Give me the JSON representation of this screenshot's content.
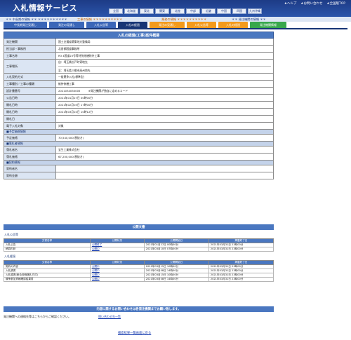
{
  "header": {
    "logo": "入札情報サービス",
    "util_links": [
      "★ヘルプ",
      "★お問い合わせ",
      "★全国版TOP"
    ],
    "regions": [
      "全国",
      "北海道",
      "東北",
      "関東",
      "北陸",
      "中部",
      "近畿",
      "中国",
      "四国",
      "九州沖縄"
    ]
  },
  "sections": {
    "a": "＊＊ 中長期の情報 ＊＊ ＊＊＊＊＊＊＊＊＊＊",
    "b": "工事の情報 ＊＊＊＊＊＊＊＊＊＊",
    "c": "業務の情報 ＊＊＊＊＊＊＊＊＊＊",
    "d": "＊＊ 発注機関の情報 ＊＊"
  },
  "tabs": [
    {
      "label": "中長期発注見通し",
      "style": "blue"
    },
    {
      "label": "発注の見通し",
      "style": "blue"
    },
    {
      "label": "入札公告等",
      "style": "blue"
    },
    {
      "label": "入札の経過",
      "style": "active"
    },
    {
      "label": "発注の見通し",
      "style": "orange"
    },
    {
      "label": "入札公告等",
      "style": "orange"
    },
    {
      "label": "入札の経過",
      "style": "orange"
    },
    {
      "label": "発注機関情報",
      "style": "green"
    }
  ],
  "detail": {
    "title": "入札の経過(工事)案件概要",
    "rows": [
      {
        "label": "発注機関",
        "value": [
          "国土交通省関東地方整備局"
        ],
        "h": 10
      },
      {
        "label": "担当部・事務所",
        "value": [
          "北首都国道事務所"
        ],
        "h": 10
      },
      {
        "label": "工事名称",
        "value": [
          "R3 4国道23号等特別修繕除外工事"
        ],
        "h": 10
      },
      {
        "label": "工事場所",
        "value": [
          "自：埼玉県杉戸町寄地先",
          "至：埼玉県三郷市高州地先"
        ],
        "h": 20
      },
      {
        "label": "入札契約方式",
        "value": [
          "一般競争入札(標準型)"
        ],
        "h": 10
      },
      {
        "label": "工事種別／工事の種類",
        "value": [
          "維持修繕工事"
        ],
        "h": 10
      },
      {
        "label": "設計書番号",
        "value": [
          "2021034050005　　　※発注機関が独自に定めるコード"
        ],
        "h": 10
      },
      {
        "label": "公告日時",
        "value": [
          "2021年01月27日 00時00分"
        ],
        "h": 10
      },
      {
        "label": "開札日時",
        "value": [
          "2021年02月03日 17時00分"
        ],
        "h": 10
      },
      {
        "label": "開札日時",
        "value": [
          "2021年03月10日 10時12分"
        ],
        "h": 10
      },
      {
        "label": "開札日",
        "value": [
          ""
        ],
        "h": 10
      },
      {
        "label": "電子入札対象",
        "value": [
          "対象"
        ],
        "h": 10
      }
    ],
    "group1": "■予定価格情報",
    "group1_rows": [
      {
        "label": "予定価格",
        "value": [
          "70,540,000(税抜き)"
        ],
        "h": 10
      }
    ],
    "group2": "■落札者情報",
    "group2_rows": [
      {
        "label": "落札者名",
        "value": [
          "宝生工業株式会社"
        ],
        "h": 10
      },
      {
        "label": "落札価格",
        "value": [
          "67,200,000(税抜き)"
        ],
        "h": 10
      }
    ],
    "group3": "■契約情報",
    "group3_rows": [
      {
        "label": "契約者名",
        "value": [
          ""
        ],
        "h": 10
      },
      {
        "label": "契約金額",
        "value": [
          ""
        ],
        "h": 10
      }
    ]
  },
  "documents": {
    "head": "公開文書",
    "announce_label": "入札公告等",
    "columns": [
      "文書名称",
      "公開状況",
      "公開開始日",
      "掲載終了日"
    ],
    "announce_rows": [
      [
        "入札公告",
        "公開終了",
        "2021年01月27日 00時00分",
        "2021年03月31日 23時00分"
      ],
      [
        "積算内訳",
        "公開中",
        "2021年03月10日 07時00分",
        "2021年03月31日 23時00分"
      ]
    ],
    "result_label": "入札経過",
    "result_rows": [
      [
        "契約の内容",
        "公開中",
        "2021年03月15日 10時00分",
        "2021年03月31日 23時00分"
      ],
      [
        "入札調書",
        "公開中",
        "2021年03月08日 14時00分",
        "2021年03月31日 23時00分"
      ],
      [
        "入札調書(総合評価落札方式)",
        "公開中",
        "2021年03月15日 10時00分",
        "2021年03月31日 23時00分"
      ],
      [
        "競争参加資格確認結果書",
        "公開中",
        "2021年03月08日 14時00分",
        "2021年03月31日 23時00分"
      ]
    ]
  },
  "contact": {
    "head": "内容に関するお問い合わせは各発注機関までお願い致します。",
    "text": "発注機関への連絡先等はこちらからご確認ください。",
    "link": "問い合わせ先一覧"
  },
  "footer": {
    "back": "検索結果一覧画面に戻る"
  }
}
